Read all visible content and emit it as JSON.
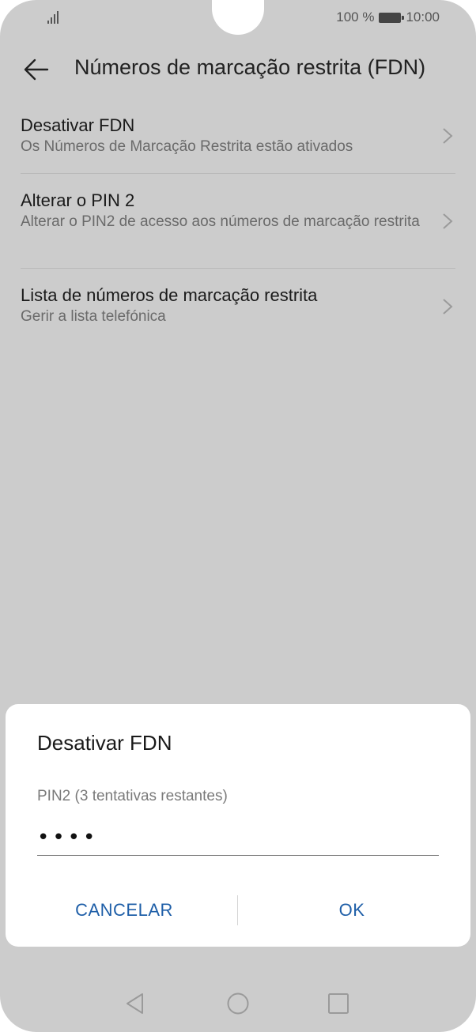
{
  "status_bar": {
    "battery_text": "100 %",
    "time": "10:00",
    "signal_icon": "signal-icon",
    "battery_icon": "battery-icon"
  },
  "app_bar": {
    "back_icon": "back-arrow-icon",
    "title": "Números de marcação restrita (FDN)"
  },
  "list": {
    "items": [
      {
        "title": "Desativar FDN",
        "subtitle": "Os Números de Marcação Restrita estão ativados"
      },
      {
        "title": "Alterar o PIN 2",
        "subtitle": "Alterar o PIN2 de acesso aos números de marcação restrita"
      },
      {
        "title": "Lista de números de marcação restrita",
        "subtitle": "Gerir a lista telefónica"
      }
    ]
  },
  "dialog": {
    "title": "Desativar FDN",
    "field_label": "PIN2 (3 tentativas restantes)",
    "field_value": "••••",
    "cancel_label": "CANCELAR",
    "ok_label": "OK"
  },
  "nav_bar": {
    "back_icon": "nav-back-icon",
    "home_icon": "nav-home-icon",
    "recents_icon": "nav-recents-icon"
  },
  "colors": {
    "background": "#cccccc",
    "dialog": "#ffffff",
    "accent": "#1f5fa8"
  }
}
